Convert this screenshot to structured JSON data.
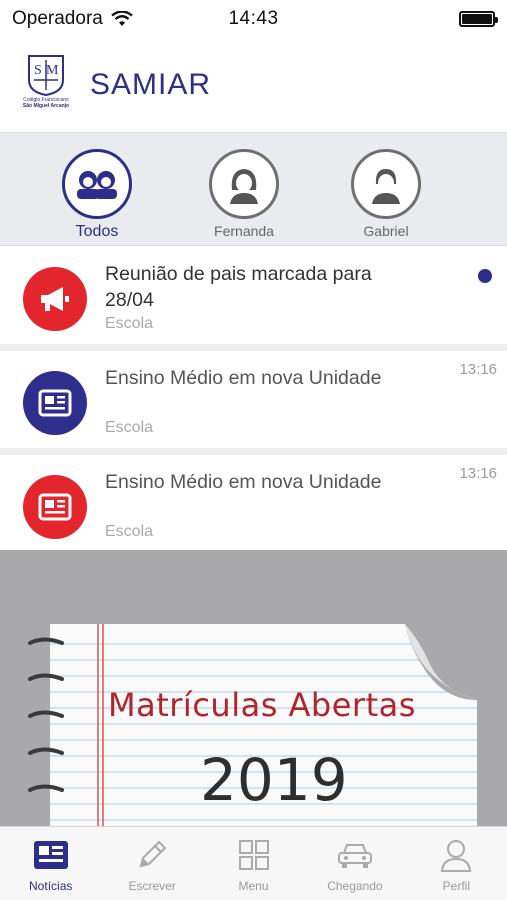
{
  "status_bar": {
    "carrier": "Operadora",
    "time": "14:43"
  },
  "header": {
    "title": "SAMIAR",
    "logo_caption_1": "Colégio Franciscano",
    "logo_caption_2": "São Miguel Arcanjo"
  },
  "children": [
    {
      "label": "Todos",
      "active": true
    },
    {
      "label": "Fernanda",
      "active": false
    },
    {
      "label": "Gabriel",
      "active": false
    }
  ],
  "feed": [
    {
      "title": "Reunião de pais marcada para 28/04",
      "source": "Escola",
      "time": "",
      "icon": "megaphone-icon",
      "color": "#e3262d",
      "unread": true
    },
    {
      "title": "Ensino Médio em nova Unidade",
      "source": "Escola",
      "time": "13:16",
      "icon": "newspaper-icon",
      "color": "#2e2e8c",
      "unread": false
    },
    {
      "title": "Ensino Médio em nova Unidade",
      "source": "Escola",
      "time": "13:16",
      "icon": "newspaper-icon",
      "color": "#e3262d",
      "unread": false
    }
  ],
  "banner": {
    "headline": "Matrículas Abertas",
    "year": "2019"
  },
  "tabs": [
    {
      "label": "Notícias",
      "icon": "newspaper-icon",
      "active": true
    },
    {
      "label": "Escrever",
      "icon": "pencil-icon",
      "active": false
    },
    {
      "label": "Menu",
      "icon": "grid-icon",
      "active": false
    },
    {
      "label": "Chegando",
      "icon": "car-icon",
      "active": false
    },
    {
      "label": "Perfil",
      "icon": "person-icon",
      "active": false
    }
  ],
  "colors": {
    "brand": "#2d2d8a",
    "alert_red": "#e3262d",
    "divider": "#eeeff1"
  }
}
